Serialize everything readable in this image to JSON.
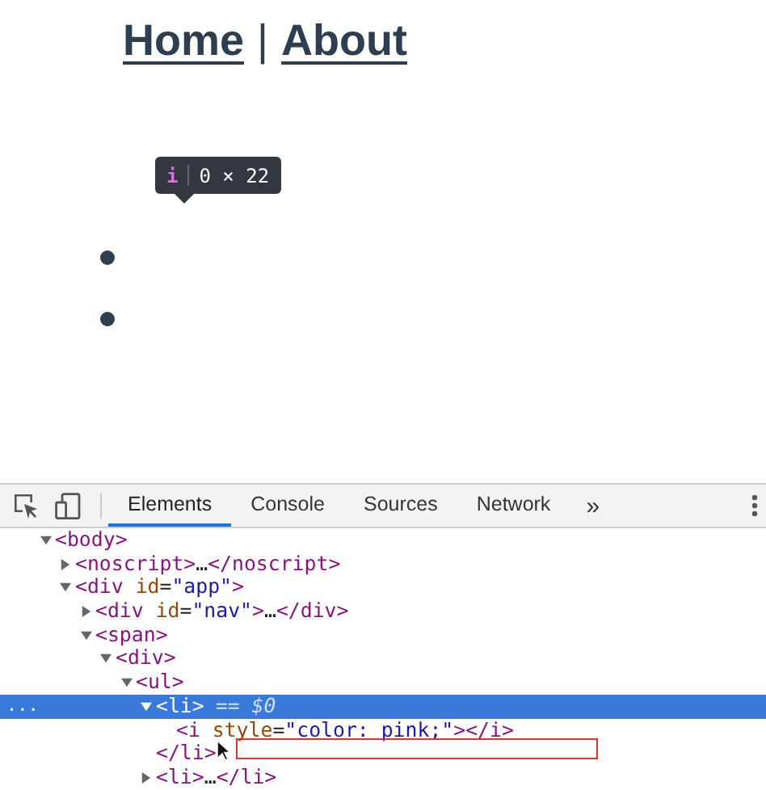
{
  "page": {
    "nav": {
      "links": [
        {
          "label": "Home"
        },
        {
          "label": "About"
        }
      ],
      "separator": "|"
    },
    "tooltip": {
      "tag": "i",
      "size": "0 × 22"
    },
    "list_items": [
      {
        "kind": "bullet"
      },
      {
        "kind": "bullet"
      }
    ]
  },
  "devtools": {
    "tabs": [
      {
        "label": "Elements",
        "selected": true
      },
      {
        "label": "Console",
        "selected": false
      },
      {
        "label": "Sources",
        "selected": false
      },
      {
        "label": "Network",
        "selected": false
      }
    ],
    "overflow": "»",
    "selected_marker": "...",
    "tree": [
      {
        "text": "<body>",
        "expanded": true,
        "selected": false,
        "children": [
          {
            "text": "<noscript>…</noscript>",
            "expanded": false,
            "selected": false
          },
          {
            "text": "<div id=\"app\">",
            "expanded": true,
            "selected": false,
            "children": [
              {
                "text": "<div id=\"nav\">…</div>",
                "expanded": false,
                "selected": false
              },
              {
                "text": "<span>",
                "expanded": true,
                "selected": false,
                "children": [
                  {
                    "text": "<div>",
                    "expanded": true,
                    "selected": false,
                    "children": [
                      {
                        "text": "<ul>",
                        "expanded": true,
                        "selected": false,
                        "children": [
                          {
                            "text": "<li>",
                            "suffix": "== $0",
                            "expanded": true,
                            "selected": true,
                            "closing": "</li>",
                            "children": [
                              {
                                "text": "<i style=\"color: pink;\"></i>",
                                "selected": false
                              }
                            ]
                          },
                          {
                            "text": "<li>…</li>",
                            "expanded": false,
                            "selected": false
                          }
                        ]
                      }
                    ]
                  }
                ]
              }
            ]
          }
        ]
      }
    ]
  }
}
